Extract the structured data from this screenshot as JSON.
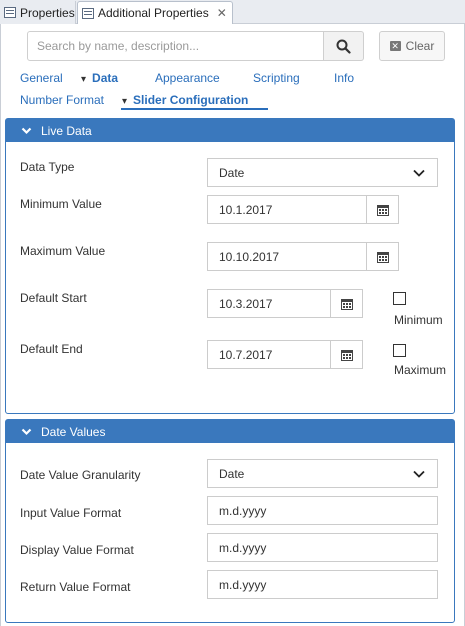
{
  "tabs": {
    "properties_label": "Properties",
    "additional_label": "Additional Properties"
  },
  "search": {
    "placeholder": "Search by name, description...",
    "clear_label": "Clear"
  },
  "nav": {
    "general": "General",
    "data": "Data",
    "appearance": "Appearance",
    "scripting": "Scripting",
    "info": "Info",
    "number_format": "Number Format",
    "slider_configuration": "Slider Configuration"
  },
  "live_data": {
    "title": "Live Data",
    "data_type_label": "Data Type",
    "data_type_value": "Date",
    "min_label": "Minimum Value",
    "min_value": "10.1.2017",
    "max_label": "Maximum Value",
    "max_value": "10.10.2017",
    "default_start_label": "Default Start",
    "default_start_value": "10.3.2017",
    "default_start_check": "Minimum",
    "default_end_label": "Default End",
    "default_end_value": "10.7.2017",
    "default_end_check": "Maximum"
  },
  "date_values": {
    "title": "Date Values",
    "granularity_label": "Date Value Granularity",
    "granularity_value": "Date",
    "input_format_label": "Input Value Format",
    "input_format_value": "m.d.yyyy",
    "display_format_label": "Display Value Format",
    "display_format_value": "m.d.yyyy",
    "return_format_label": "Return Value Format",
    "return_format_value": "m.d.yyyy"
  },
  "colors": {
    "accent": "#3a78bd",
    "link": "#2a6ebb"
  }
}
